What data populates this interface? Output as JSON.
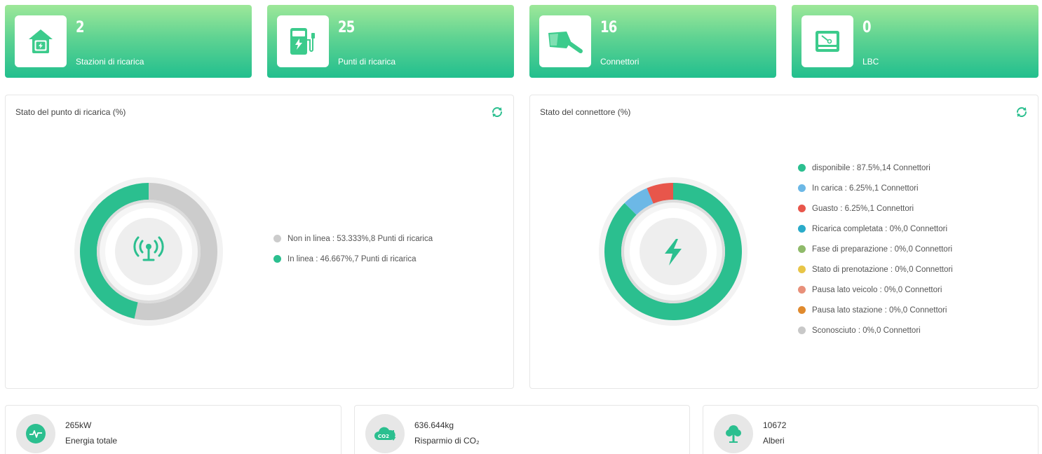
{
  "stats": [
    {
      "value": "2",
      "label": "Stazioni di ricarica",
      "icon": "house-charge-icon"
    },
    {
      "value": "25",
      "label": "Punti di ricarica",
      "icon": "charging-pump-icon"
    },
    {
      "value": "16",
      "label": "Connettori",
      "icon": "connector-plug-icon"
    },
    {
      "value": "0",
      "label": "LBC",
      "icon": "lbc-meter-icon"
    }
  ],
  "charging_point_panel": {
    "title": "Stato del punto di ricarica (%)",
    "center_icon": "antenna-signal-icon",
    "legend": [
      {
        "text": "Non in linea : 53.333%,8 Punti di ricarica",
        "color": "#cccccc"
      },
      {
        "text": "In linea : 46.667%,7 Punti di ricarica",
        "color": "#2bbf8f"
      }
    ]
  },
  "connector_panel": {
    "title": "Stato del connettore (%)",
    "center_icon": "lightning-bolt-icon",
    "legend": [
      {
        "text": "disponibile : 87.5%,14 Connettori",
        "color": "#2bbf8f"
      },
      {
        "text": "In carica : 6.25%,1 Connettori",
        "color": "#6cb8e6"
      },
      {
        "text": "Guasto : 6.25%,1 Connettori",
        "color": "#e8564b"
      },
      {
        "text": "Ricarica completata : 0%,0 Connettori",
        "color": "#2aabc9"
      },
      {
        "text": "Fase di preparazione : 0%,0 Connettori",
        "color": "#8fba6a"
      },
      {
        "text": "Stato di prenotazione : 0%,0 Connettori",
        "color": "#e8c547"
      },
      {
        "text": "Pausa lato veicolo : 0%,0 Connettori",
        "color": "#e8907a"
      },
      {
        "text": "Pausa lato stazione : 0%,0 Connettori",
        "color": "#e08a2e"
      },
      {
        "text": "Sconosciuto : 0%,0 Connettori",
        "color": "#c8c8c8"
      }
    ]
  },
  "chart_data": [
    {
      "type": "pie",
      "title": "Stato del punto di ricarica (%)",
      "categories": [
        "Non in linea",
        "In linea"
      ],
      "values": [
        53.333,
        46.667
      ],
      "counts": [
        8,
        7
      ],
      "colors": [
        "#cccccc",
        "#2bbf8f"
      ],
      "donut": true
    },
    {
      "type": "pie",
      "title": "Stato del connettore (%)",
      "categories": [
        "disponibile",
        "In carica",
        "Guasto",
        "Ricarica completata",
        "Fase di preparazione",
        "Stato di prenotazione",
        "Pausa lato veicolo",
        "Pausa lato stazione",
        "Sconosciuto"
      ],
      "values": [
        87.5,
        6.25,
        6.25,
        0,
        0,
        0,
        0,
        0,
        0
      ],
      "counts": [
        14,
        1,
        1,
        0,
        0,
        0,
        0,
        0,
        0
      ],
      "colors": [
        "#2bbf8f",
        "#6cb8e6",
        "#e8564b",
        "#2aabc9",
        "#8fba6a",
        "#e8c547",
        "#e8907a",
        "#e08a2e",
        "#c8c8c8"
      ],
      "donut": true
    }
  ],
  "bottom": [
    {
      "value": "265kW",
      "label": "Energia totale",
      "icon": "pulse-icon"
    },
    {
      "value": "636.644kg",
      "label": "Risparmio di CO₂",
      "icon": "co2-cloud-icon"
    },
    {
      "value": "10672",
      "label": "Alberi",
      "icon": "tree-icon"
    }
  ]
}
